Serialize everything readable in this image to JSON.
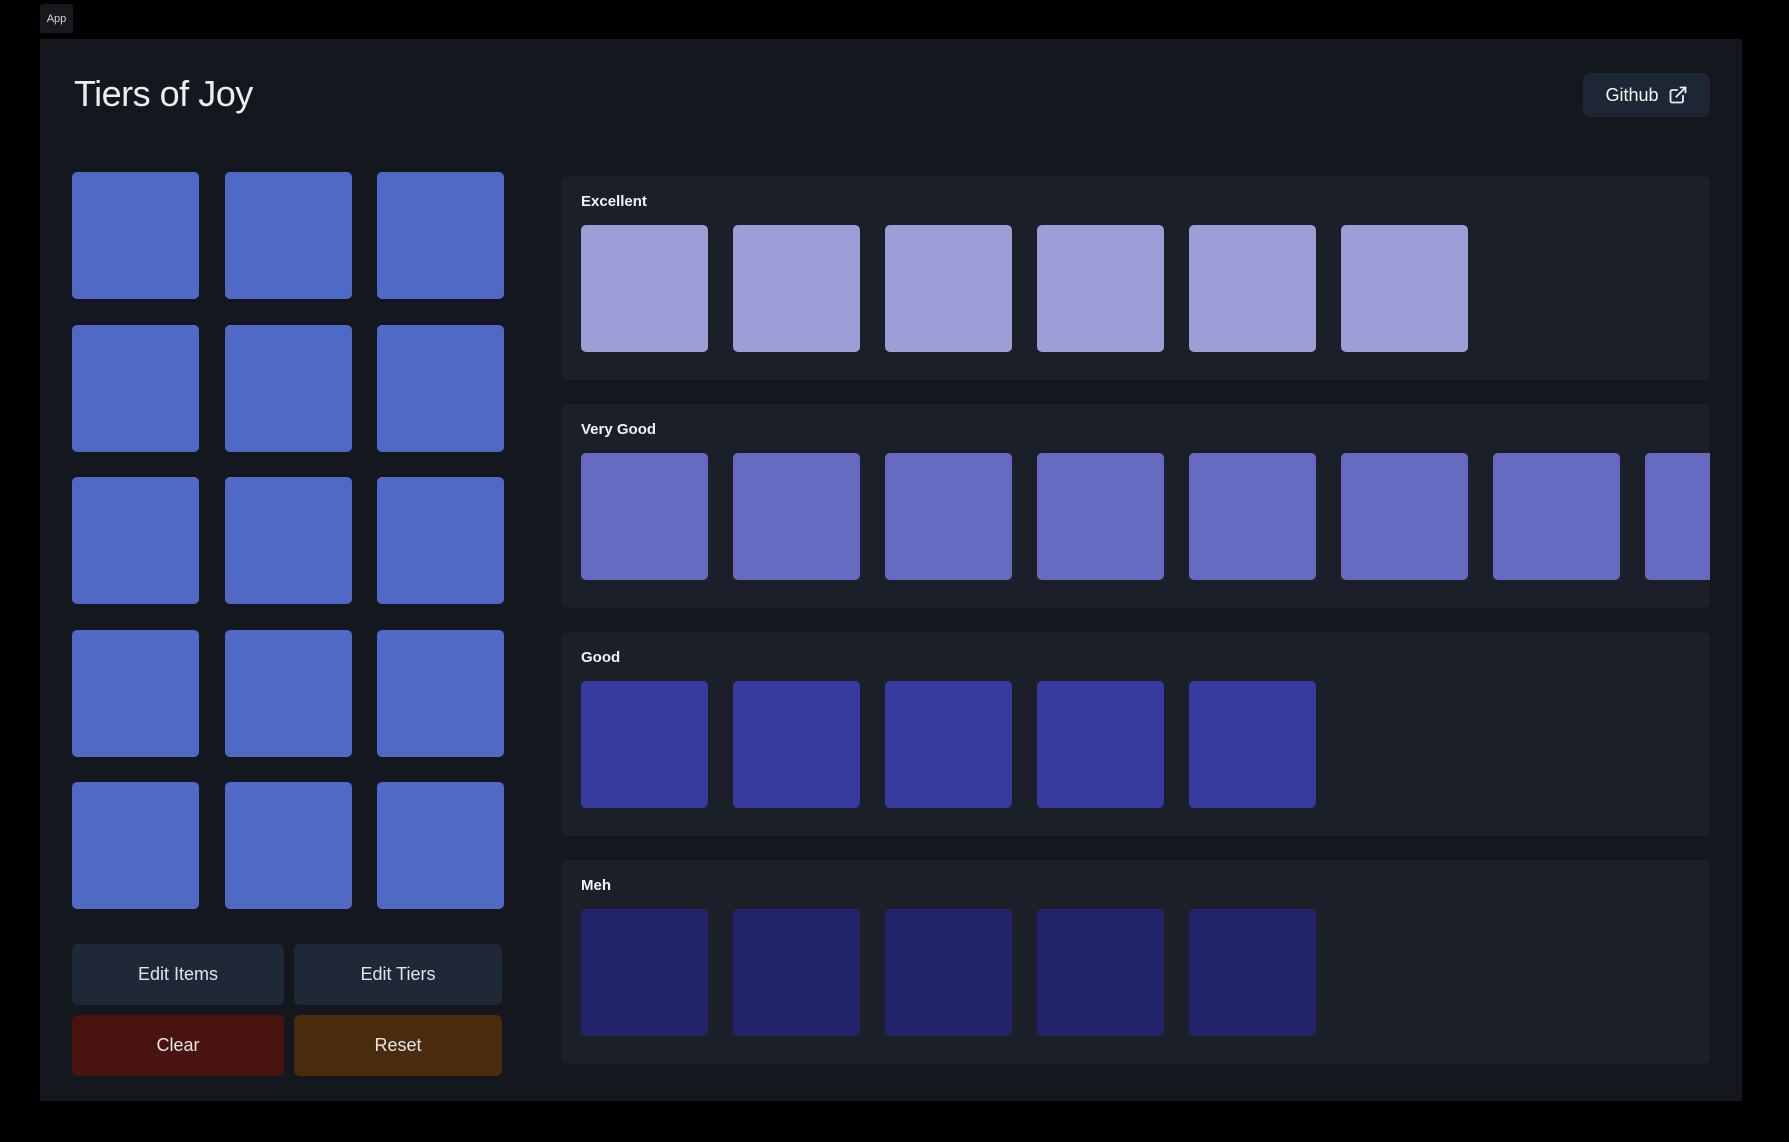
{
  "app_badge": {
    "label": "App"
  },
  "header": {
    "title": "Tiers of Joy",
    "github_label": "Github",
    "github_icon": "external-link-icon"
  },
  "colors": {
    "page_background": "#000000",
    "app_background": "#15171e",
    "tier_row_background": "#1b1f27",
    "panel_button_background": "#1e2836",
    "clear_button_background": "#491310",
    "reset_button_background": "#4a2b0d",
    "github_button_background": "#1d2634",
    "text_primary": "#edeef0",
    "pool_item_color": "#4f69c5"
  },
  "pool": {
    "item_count": 15,
    "item_color": "#4f69c5"
  },
  "actions": {
    "edit_items": "Edit Items",
    "edit_tiers": "Edit Tiers",
    "clear": "Clear",
    "reset": "Reset"
  },
  "tiers": [
    {
      "label": "Excellent",
      "item_color": "#9d9ed7",
      "item_count": 6
    },
    {
      "label": "Very Good",
      "item_color": "#666ac0",
      "item_count": 8
    },
    {
      "label": "Good",
      "item_color": "#363a9e",
      "item_count": 5
    },
    {
      "label": "Meh",
      "item_color": "#212468",
      "item_count": 5
    }
  ]
}
